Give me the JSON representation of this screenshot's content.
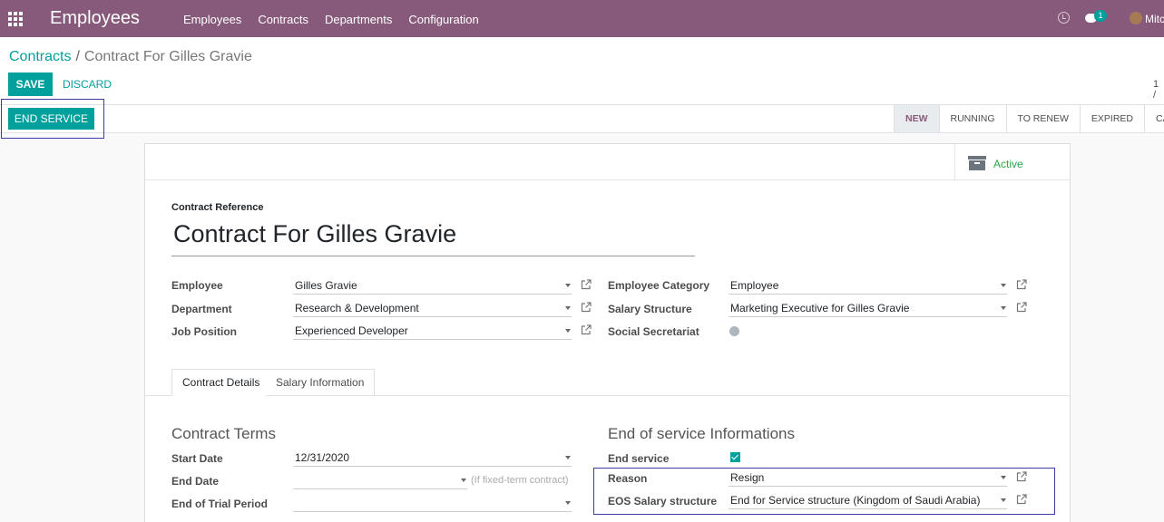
{
  "topbar": {
    "app_name": "Employees",
    "menu": [
      "Employees",
      "Contracts",
      "Departments",
      "Configuration"
    ],
    "chat_count": "1",
    "user_name": "Mitc"
  },
  "breadcrumb": {
    "parent": "Contracts",
    "separator": "/",
    "current": "Contract For Gilles Gravie"
  },
  "actions": {
    "save": "SAVE",
    "discard": "DISCARD",
    "pager": "1 /"
  },
  "statusbar": {
    "end_service": "END SERVICE",
    "stages": [
      "NEW",
      "RUNNING",
      "TO RENEW",
      "EXPIRED",
      "CA"
    ],
    "active_stage": "NEW"
  },
  "sheet": {
    "active_label": "Active",
    "reference_label": "Contract Reference",
    "reference_value": "Contract For Gilles Gravie",
    "left_fields": {
      "employee_label": "Employee",
      "employee_value": "Gilles Gravie",
      "department_label": "Department",
      "department_value": "Research & Development",
      "job_label": "Job Position",
      "job_value": "Experienced Developer"
    },
    "right_fields": {
      "category_label": "Employee Category",
      "category_value": "Employee",
      "structure_label": "Salary Structure",
      "structure_value": "Marketing Executive for Gilles Gravie",
      "social_label": "Social Secretariat"
    },
    "tabs": [
      "Contract Details",
      "Salary Information"
    ],
    "contract_terms": {
      "title": "Contract Terms",
      "start_label": "Start Date",
      "start_value": "12/31/2020",
      "end_label": "End Date",
      "end_hint": "(If fixed-term contract)",
      "trial_label": "End of Trial Period"
    },
    "eos": {
      "title": "End of service Informations",
      "end_service_label": "End service",
      "reason_label": "Reason",
      "reason_value": "Resign",
      "salary_label": "EOS Salary structure",
      "salary_value": "End for Service structure (Kingdom of Saudi Arabia)"
    }
  },
  "colors": {
    "brand": "#875a7b",
    "accent": "#00a09d",
    "highlight": "#3a3ba3",
    "active": "#28a745"
  }
}
